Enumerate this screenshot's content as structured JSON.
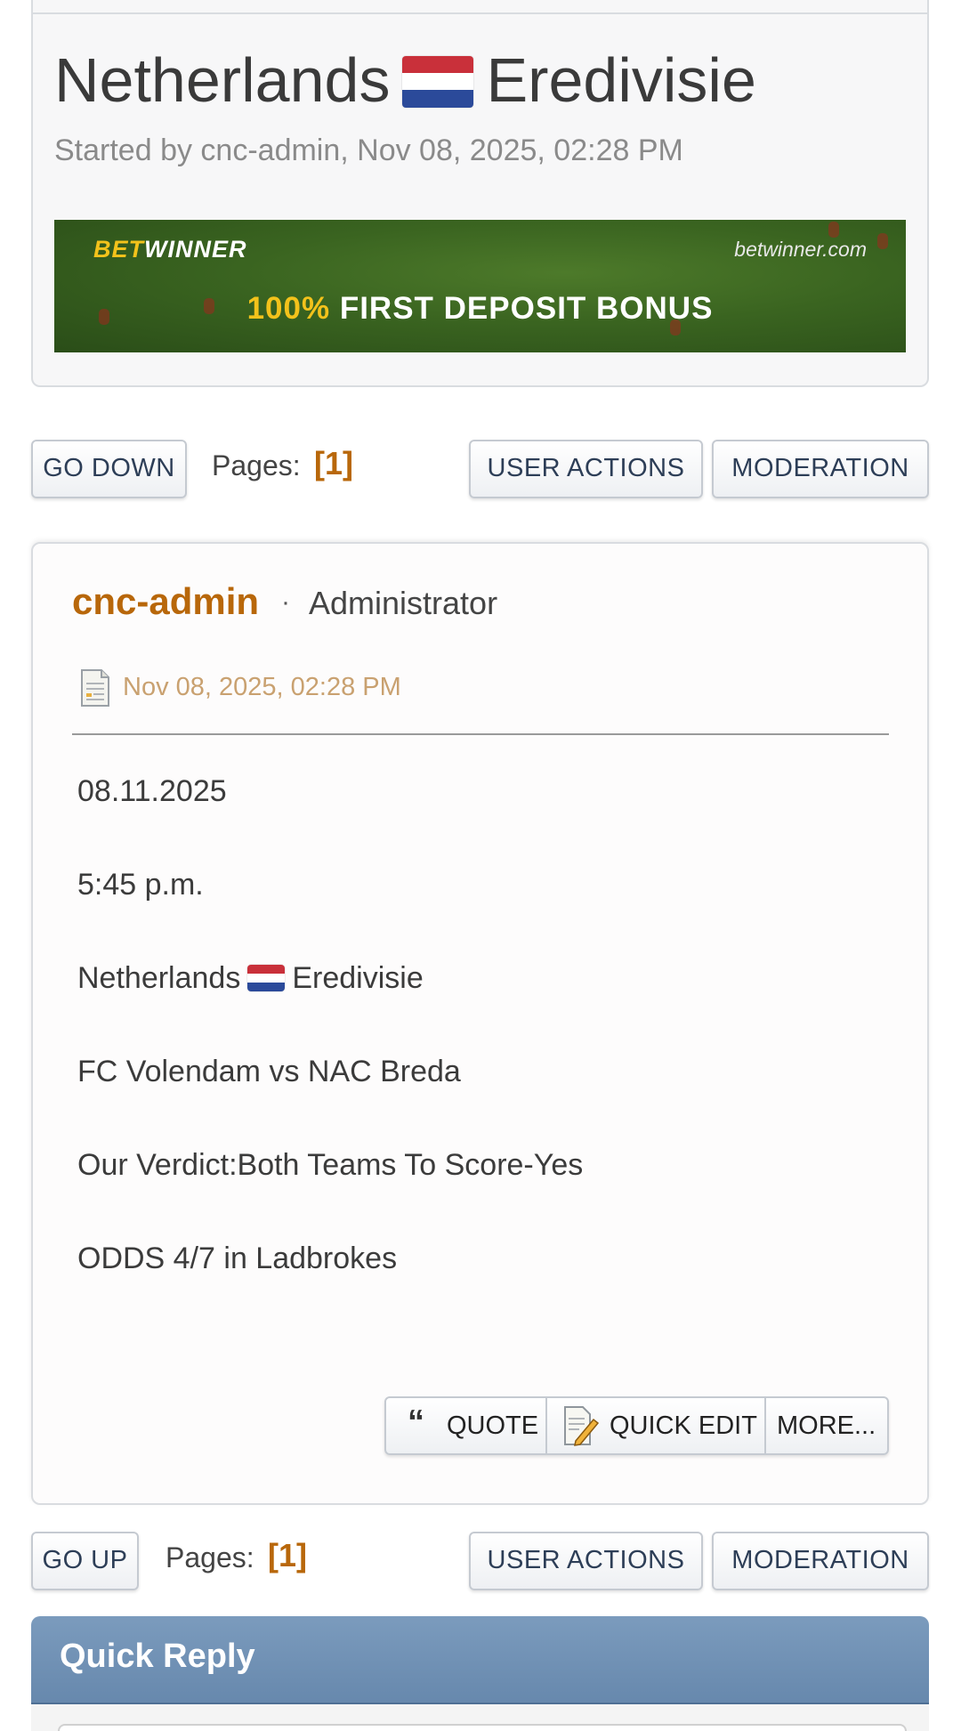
{
  "topic": {
    "title_left": "Netherlands",
    "title_right": "Eredivisie",
    "flag": "netherlands-flag",
    "started_by": "Started by cnc-admin, Nov 08, 2025, 02:28 PM"
  },
  "banner": {
    "brand_bet": "BET",
    "brand_winner": "WINNER",
    "domain": "betwinner.com",
    "headline_pct": "100%",
    "headline_text": " FIRST DEPOSIT BONUS"
  },
  "nav_top": {
    "go_down": "GO DOWN",
    "pages_label": "Pages:",
    "pages_current": "[1]",
    "user_actions": "USER ACTIONS",
    "moderation": "MODERATION"
  },
  "post": {
    "author": "cnc-admin",
    "separator": "·",
    "group": "Administrator",
    "date": "Nov 08, 2025, 02:28 PM",
    "lines": [
      "08.11.2025",
      "5:45 p.m.",
      "Eredivisie",
      "FC Volendam vs NAC Breda",
      "Our Verdict:Both Teams To Score-Yes",
      "ODDS 4/7 in Ladbrokes"
    ],
    "line3_prefix": "Netherlands",
    "actions": {
      "quote": "QUOTE",
      "quick_edit": "QUICK EDIT",
      "more": "MORE..."
    }
  },
  "nav_bottom": {
    "go_up": "GO UP",
    "pages_label": "Pages:",
    "pages_current": "[1]",
    "user_actions": "USER ACTIONS",
    "moderation": "MODERATION"
  },
  "quick_reply": {
    "title": "Quick Reply"
  },
  "colors": {
    "accent_orange": "#b8670a",
    "date_tan": "#c9a170",
    "quick_reply_blue": "#5e80a6"
  }
}
